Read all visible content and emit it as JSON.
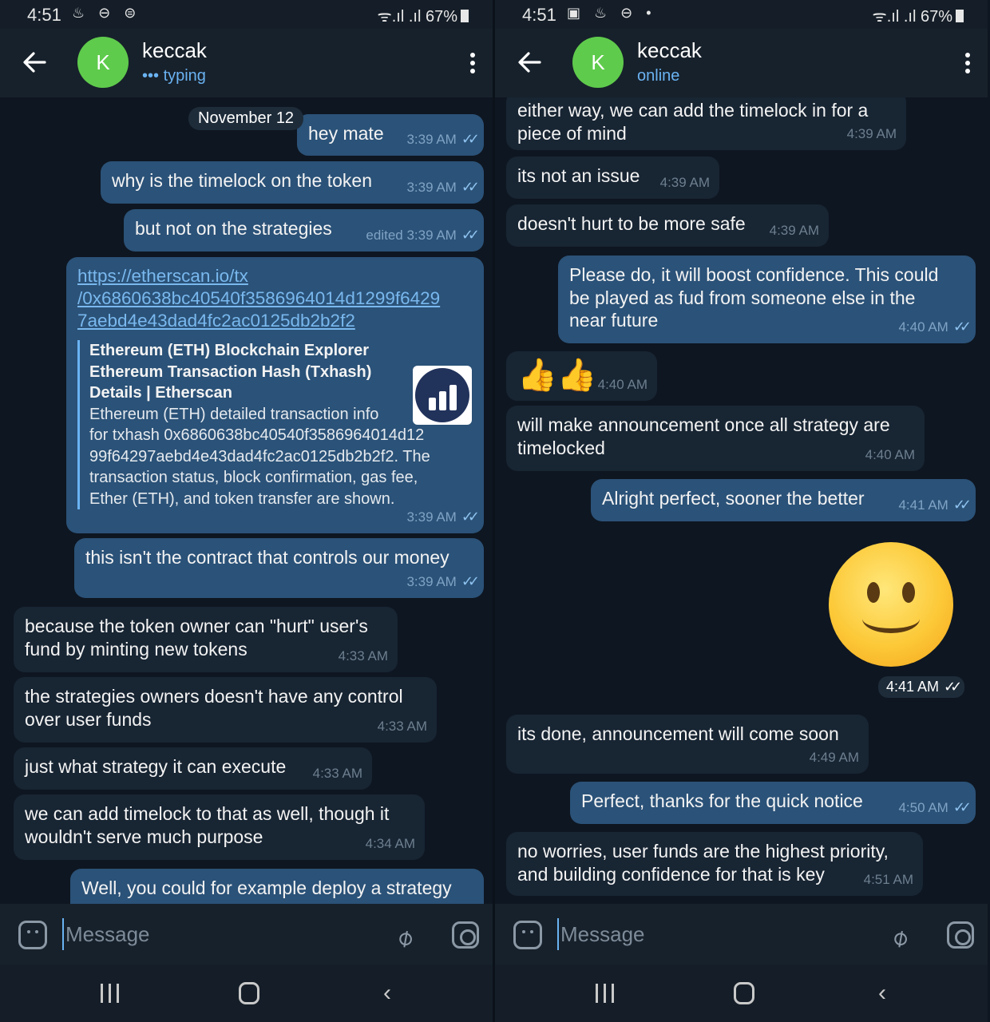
{
  "left": {
    "status": {
      "time": "4:51",
      "icons": "♨ ⊖ ⊜",
      "signal": "ᯤ.ıl .ıl",
      "battery": "67%"
    },
    "header": {
      "avatar_letter": "K",
      "name": "keccak",
      "status": "••• typing"
    },
    "date": "November 12",
    "messages": [
      {
        "text": "hey mate",
        "time": "3:39 AM"
      },
      {
        "text": "why is the timelock on the token",
        "time": "3:39 AM"
      },
      {
        "text": "but not on the strategies",
        "time": "edited 3:39 AM"
      },
      {
        "link_text": "https://etherscan.io/tx\n/0x6860638bc40540f3586964014d1299f6429\n7aebd4e43dad4fc2ac0125db2b2f2",
        "preview_title": "Ethereum (ETH) Blockchain Explorer\nEthereum Transaction Hash (Txhash)\nDetails | Etherscan",
        "preview_desc": "Ethereum (ETH) detailed transaction info\nfor txhash 0x6860638bc40540f3586964014d12\n99f64297aebd4e43dad4fc2ac0125db2b2f2. The\ntransaction status, block confirmation, gas fee,\nEther (ETH), and token transfer are shown.",
        "time": "3:39 AM"
      },
      {
        "text": "this isn't the contract that controls our money",
        "time": "3:39 AM"
      },
      {
        "text": "because the token owner can \"hurt\" user's\nfund by minting new tokens",
        "time": "4:33 AM"
      },
      {
        "text": "the strategies owners doesn't have any control\nover user funds",
        "time": "4:33 AM"
      },
      {
        "text": "just what strategy it can execute",
        "time": "4:33 AM"
      },
      {
        "text": "we can add timelock to that as well, though it\nwouldn't serve much purpose",
        "time": "4:34 AM"
      },
      {
        "text": "Well, you could for example deploy a strategy",
        "time": ""
      }
    ],
    "input": {
      "placeholder": "Message"
    }
  },
  "right": {
    "status": {
      "time": "4:51",
      "icons": "▣ ♨ ⊖ •",
      "signal": "ᯤ.ıl .ıl",
      "battery": "67%"
    },
    "header": {
      "avatar_letter": "K",
      "name": "keccak",
      "status": "online"
    },
    "messages": [
      {
        "text": "either way, we can add the timelock in for a\npiece of mind",
        "time": "4:39 AM"
      },
      {
        "text": "its not an issue",
        "time": "4:39 AM"
      },
      {
        "text": "doesn't hurt to be more safe",
        "time": "4:39 AM"
      },
      {
        "text": "Please do, it will boost confidence. This could\nbe played as fud from someone else in the\nnear future",
        "time": "4:40 AM"
      },
      {
        "text": "👍👍",
        "time": "4:40 AM"
      },
      {
        "text": "will make announcement once all strategy are\ntimelocked",
        "time": "4:40 AM"
      },
      {
        "text": "Alright perfect, sooner the better",
        "time": "4:41 AM"
      },
      {
        "text": "",
        "time": "4:41 AM"
      },
      {
        "text": "its done, announcement will come soon",
        "time": "4:49 AM"
      },
      {
        "text": "Perfect, thanks for the quick notice",
        "time": "4:50 AM"
      },
      {
        "text": "no worries, user funds are the highest priority,\nand building confidence for that is key",
        "time": "4:51 AM"
      }
    ],
    "input": {
      "placeholder": "Message"
    }
  },
  "icons": {
    "back": "arrow-left-icon",
    "menu": "more-vertical-icon",
    "emoji": "sticker-smile-icon",
    "attach": "paperclip-icon",
    "camera": "camera-icon",
    "check": "double-check-icon",
    "nav_recent": "recent-apps-icon",
    "nav_home": "home-icon",
    "nav_back": "nav-back-icon"
  },
  "colors": {
    "background": "#0e1621",
    "header": "#17212b",
    "outgoing_bubble": "#2b5278",
    "incoming_bubble": "#182533",
    "accent": "#6ab3f3",
    "avatar": "#5fcb4c"
  }
}
